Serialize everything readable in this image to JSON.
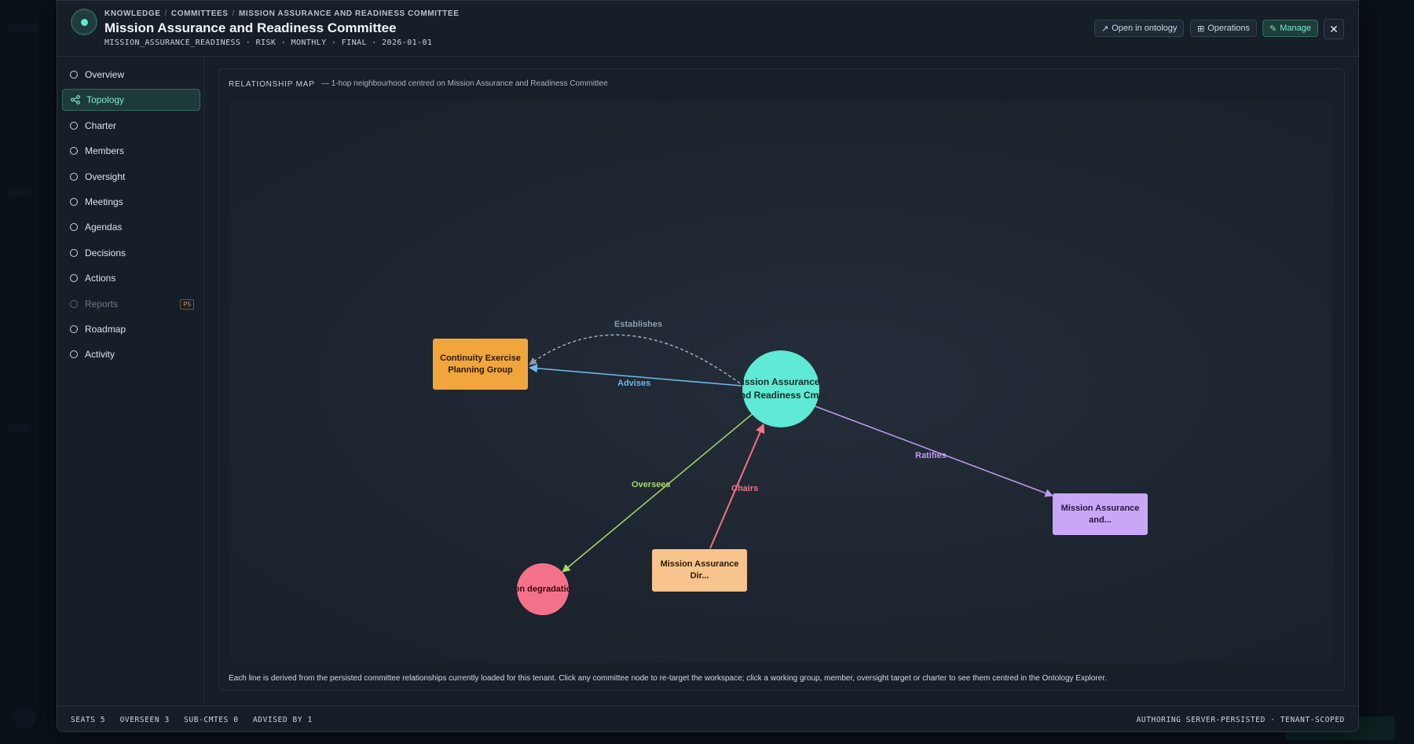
{
  "breadcrumb": [
    "KNOWLEDGE",
    "COMMITTEES",
    "MISSION ASSURANCE AND READINESS COMMITTEE"
  ],
  "title": "Mission Assurance and Readiness Committee",
  "meta": "MISSION_ASSURANCE_READINESS · RISK · MONTHLY · FINAL · 2026-01-01",
  "header_buttons": {
    "open_ontology": "Open in ontology",
    "operations": "Operations",
    "manage": "Manage",
    "close": "✕"
  },
  "icons": {
    "open": "↗",
    "operations": "⊞",
    "manage": "✎"
  },
  "nav": [
    {
      "label": "Overview"
    },
    {
      "label": "Topology",
      "active": true
    },
    {
      "label": "Charter"
    },
    {
      "label": "Members"
    },
    {
      "label": "Oversight"
    },
    {
      "label": "Meetings"
    },
    {
      "label": "Agendas"
    },
    {
      "label": "Decisions"
    },
    {
      "label": "Actions"
    },
    {
      "label": "Reports",
      "disabled": true,
      "badge": "P5"
    },
    {
      "label": "Roadmap"
    },
    {
      "label": "Activity"
    }
  ],
  "panel": {
    "title": "RELATIONSHIP MAP",
    "subtitle": "— 1-hop neighbourhood centred on Mission Assurance and Readiness Committee",
    "footnote": "Each line is derived from the persisted committee relationships currently loaded for this tenant. Click any committee node to re-target the workspace; click a working group, member, oversight target or charter to see them centred in the Ontology Explorer."
  },
  "graph": {
    "nodes": {
      "center": {
        "label": "Mission Assurance and Readiness Committee",
        "display": "ission Assurance\nand Readiness Cmte",
        "color": "#5eead4"
      },
      "continuity": {
        "label": "Continuity Exercise Planning Group",
        "color": "#f0a63c"
      },
      "director": {
        "label": "Mission Assurance Dir...",
        "color": "#f6c48c"
      },
      "ratified": {
        "label": "Mission Assurance and...",
        "color": "#c9a7f5"
      },
      "degradation": {
        "label": "on degradatio",
        "color": "#f47289"
      }
    },
    "edges": {
      "establishes": {
        "label": "Establishes",
        "color": "#8e9bb0"
      },
      "advises": {
        "label": "Advises",
        "color": "#6cb8e8"
      },
      "oversees": {
        "label": "Oversees",
        "color": "#a8d86b"
      },
      "chairs": {
        "label": "Chairs",
        "color": "#f47289"
      },
      "ratifies": {
        "label": "Ratifies",
        "color": "#c39af0"
      }
    }
  },
  "footer": {
    "stats": [
      "SEATS 5",
      "OVERSEEN 3",
      "SUB-CMTES 0",
      "ADVISED BY 1"
    ],
    "right": "AUTHORING SERVER-PERSISTED · TENANT-SCOPED"
  }
}
